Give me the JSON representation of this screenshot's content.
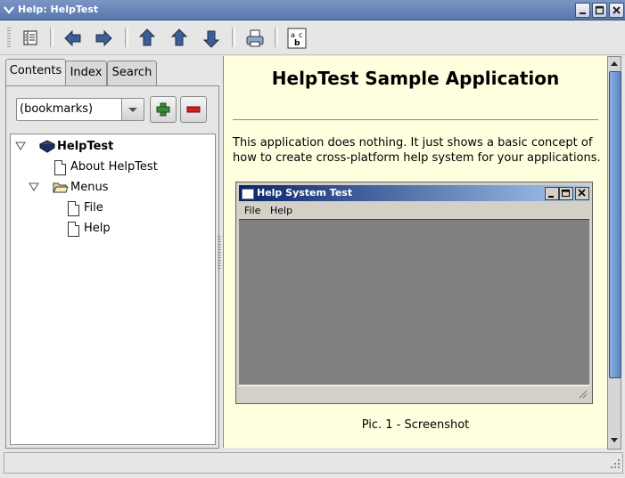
{
  "window": {
    "title": "Help: HelpTest"
  },
  "toolbar": {
    "buttons": [
      "contents-toggle",
      "back",
      "forward",
      "up",
      "previous",
      "next",
      "print",
      "font-options"
    ]
  },
  "tabs": [
    {
      "label": "Contents",
      "active": true
    },
    {
      "label": "Index",
      "active": false
    },
    {
      "label": "Search",
      "active": false
    }
  ],
  "bookmarks": {
    "selected": "(bookmarks)"
  },
  "tree": {
    "root": "HelpTest",
    "about": "About HelpTest",
    "menus": "Menus",
    "file": "File",
    "help": "Help"
  },
  "content": {
    "heading": "HelpTest Sample Application",
    "paragraph": "This application does nothing. It just shows a basic concept of how to create cross-platform help system for your applications.",
    "caption": "Pic. 1 - Screenshot",
    "screenshot": {
      "title": "Help System Test",
      "menu": [
        "File",
        "Help"
      ]
    }
  },
  "colors": {
    "content_bg": "#ffffe0",
    "title_bar": "#5877ad",
    "embedded_title": "#0a246a",
    "embedded_client": "#808080"
  }
}
